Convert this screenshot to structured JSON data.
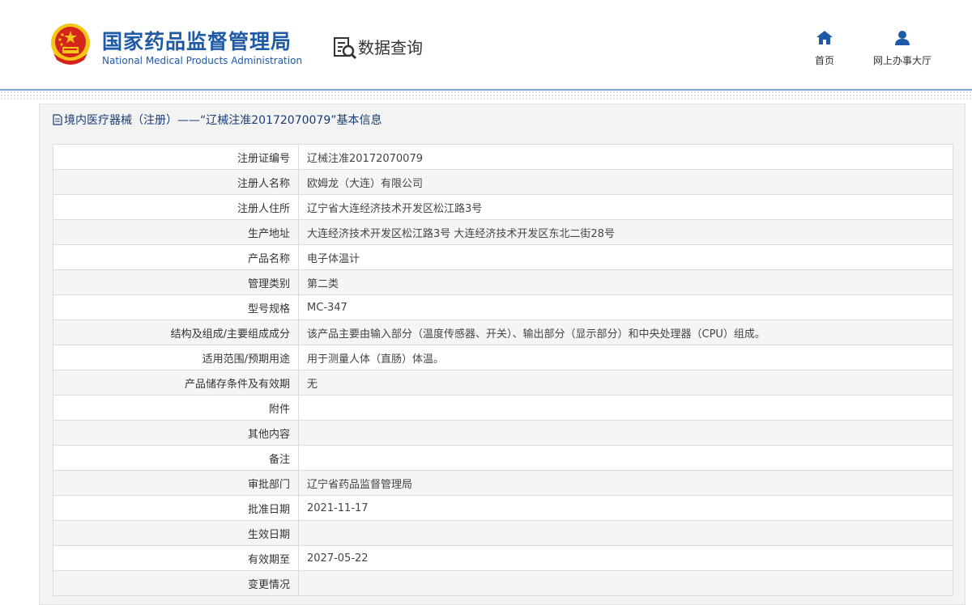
{
  "header": {
    "brand_cn": "国家药品监督管理局",
    "brand_en": "National Medical Products Administration",
    "section_label": "数据查询",
    "nav": [
      {
        "label": "首页",
        "icon": "home-icon"
      },
      {
        "label": "网上办事大厅",
        "icon": "user-icon"
      }
    ]
  },
  "panel": {
    "title": "境内医疗器械（注册）——“辽械注准20172070079”基本信息"
  },
  "rows": [
    {
      "label": "注册证编号",
      "value": "辽械注准20172070079"
    },
    {
      "label": "注册人名称",
      "value": "欧姆龙（大连）有限公司"
    },
    {
      "label": "注册人住所",
      "value": "辽宁省大连经济技术开发区松江路3号"
    },
    {
      "label": "生产地址",
      "value": "大连经济技术开发区松江路3号 大连经济技术开发区东北二街28号"
    },
    {
      "label": "产品名称",
      "value": "电子体温计"
    },
    {
      "label": "管理类别",
      "value": "第二类"
    },
    {
      "label": "型号规格",
      "value": "MC-347"
    },
    {
      "label": "结构及组成/主要组成成分",
      "value": "该产品主要由输入部分（温度传感器、开关）、输出部分（显示部分）和中央处理器（CPU）组成。"
    },
    {
      "label": "适用范围/预期用途",
      "value": "用于测量人体（直肠）体温。"
    },
    {
      "label": "产品储存条件及有效期",
      "value": "无"
    },
    {
      "label": "附件",
      "value": ""
    },
    {
      "label": "其他内容",
      "value": ""
    },
    {
      "label": "备注",
      "value": ""
    },
    {
      "label": "审批部门",
      "value": "辽宁省药品监督管理局"
    },
    {
      "label": "批准日期",
      "value": "2021-11-17"
    },
    {
      "label": "生效日期",
      "value": ""
    },
    {
      "label": "有效期至",
      "value": "2027-05-22"
    },
    {
      "label": "变更情况",
      "value": ""
    }
  ],
  "colors": {
    "brand_blue": "#1f5aa6",
    "emblem_red": "#d4241c",
    "emblem_gold": "#f5c518",
    "title_blue": "#1a3d75"
  }
}
